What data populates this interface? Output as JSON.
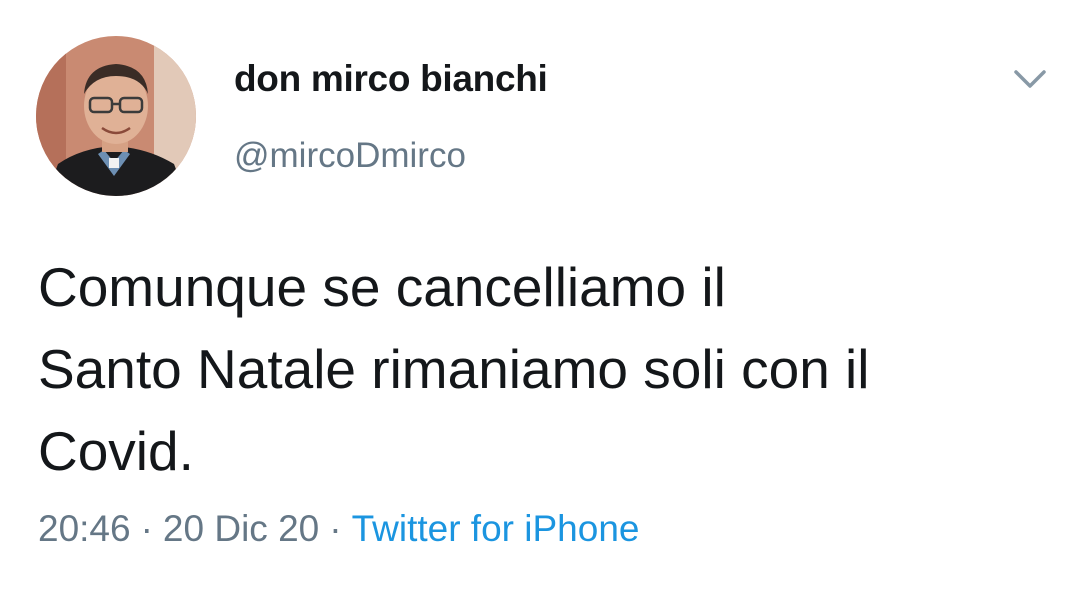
{
  "author": {
    "display_name": "don mirco bianchi",
    "handle": "@mircoDmirco",
    "avatar_icon": "profile-photo"
  },
  "menu": {
    "icon": "chevron-down-icon"
  },
  "tweet": {
    "text": "Comunque se cancelliamo il\nSanto Natale rimaniamo soli con il\nCovid."
  },
  "meta": {
    "time": "20:46",
    "separator": "·",
    "date": "20 Dic 20",
    "source": "Twitter for iPhone"
  },
  "colors": {
    "text": "#14171a",
    "secondary": "#657786",
    "link": "#1b95e0",
    "background": "#ffffff"
  }
}
